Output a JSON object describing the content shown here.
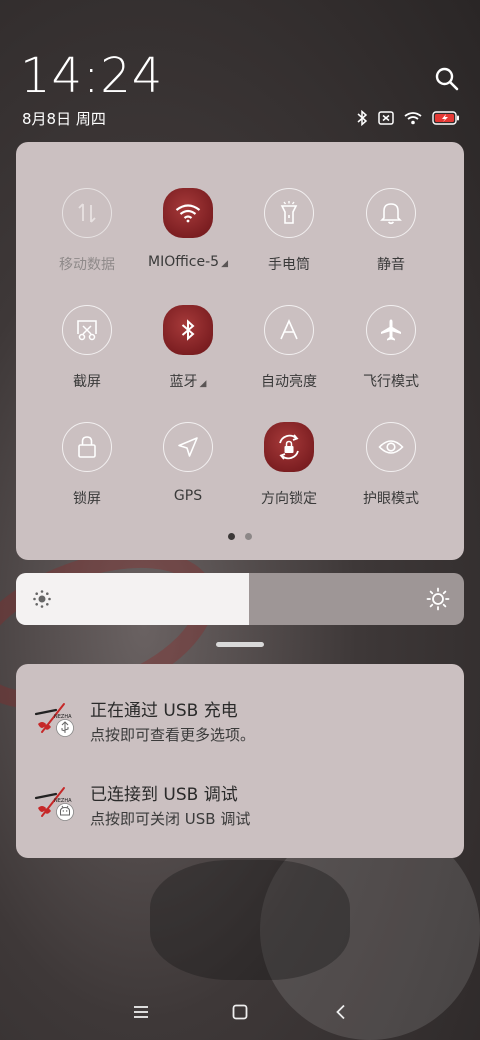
{
  "status": {
    "time": "14:24",
    "date": "8月8日 周四",
    "icons": [
      "bluetooth-icon",
      "no-sim-icon",
      "wifi-icon",
      "battery-charging-icon"
    ]
  },
  "quick_settings": {
    "tiles": [
      {
        "label": "移动数据",
        "icon": "mobile-data-icon",
        "state": "disabled"
      },
      {
        "label": "MIOffice-5",
        "icon": "wifi-icon",
        "state": "active"
      },
      {
        "label": "手电筒",
        "icon": "flashlight-icon",
        "state": "off"
      },
      {
        "label": "静音",
        "icon": "bell-icon",
        "state": "off"
      },
      {
        "label": "截屏",
        "icon": "screenshot-icon",
        "state": "off"
      },
      {
        "label": "蓝牙",
        "icon": "bluetooth-icon",
        "state": "active"
      },
      {
        "label": "自动亮度",
        "icon": "auto-brightness-icon",
        "state": "off"
      },
      {
        "label": "飞行模式",
        "icon": "airplane-icon",
        "state": "off"
      },
      {
        "label": "锁屏",
        "icon": "lock-icon",
        "state": "off"
      },
      {
        "label": "GPS",
        "icon": "location-icon",
        "state": "off"
      },
      {
        "label": "方向锁定",
        "icon": "rotation-lock-icon",
        "state": "active"
      },
      {
        "label": "护眼模式",
        "icon": "eye-icon",
        "state": "off"
      }
    ],
    "page_count": 2,
    "current_page": 1
  },
  "brightness": {
    "level_percent": 52
  },
  "notifications": [
    {
      "title": "正在通过 USB 充电",
      "subtitle": "点按即可查看更多选项。",
      "app_icon": "nezha-app-icon",
      "badge_icon": "usb-icon"
    },
    {
      "title": "已连接到 USB 调试",
      "subtitle": "点按即可关闭 USB 调试",
      "app_icon": "nezha-app-icon",
      "badge_icon": "android-debug-icon"
    }
  ],
  "app_icon_text": "NEZHA",
  "colors": {
    "panel": "#cbc0c1",
    "active_tile": "#7d1f22",
    "battery_red": "#e53935"
  }
}
